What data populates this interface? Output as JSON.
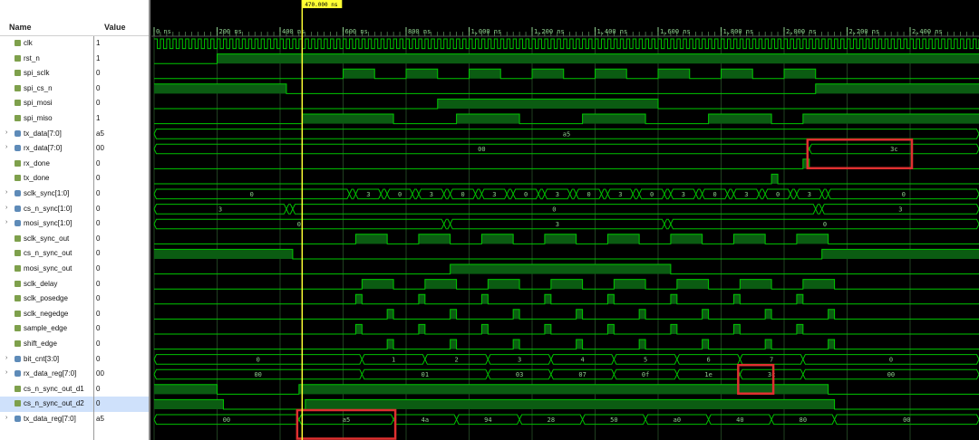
{
  "header": {
    "name_col": "Name",
    "value_col": "Value"
  },
  "cursor": {
    "label": "470.000 ns",
    "time_ns": 470
  },
  "timeline": {
    "ticks": [
      "0 ns",
      "200 ns",
      "400 ns",
      "600 ns",
      "800 ns",
      "1,000 ns",
      "1,200 ns",
      "1,400 ns",
      "1,600 ns",
      "1,800 ns",
      "2,000 ns",
      "2,200 ns",
      "2,400 ns"
    ]
  },
  "signals": [
    {
      "name": "clk",
      "value": "1",
      "kind": "bit",
      "expand": false
    },
    {
      "name": "rst_n",
      "value": "1",
      "kind": "bit",
      "expand": false
    },
    {
      "name": "spi_sclk",
      "value": "0",
      "kind": "bit",
      "expand": false
    },
    {
      "name": "spi_cs_n",
      "value": "0",
      "kind": "bit",
      "expand": false
    },
    {
      "name": "spi_mosi",
      "value": "0",
      "kind": "bit",
      "expand": false
    },
    {
      "name": "spi_miso",
      "value": "1",
      "kind": "bit",
      "expand": false
    },
    {
      "name": "tx_data[7:0]",
      "value": "a5",
      "kind": "bus",
      "expand": true
    },
    {
      "name": "rx_data[7:0]",
      "value": "00",
      "kind": "bus",
      "expand": true
    },
    {
      "name": "rx_done",
      "value": "0",
      "kind": "bit",
      "expand": false
    },
    {
      "name": "tx_done",
      "value": "0",
      "kind": "bit",
      "expand": false
    },
    {
      "name": "sclk_sync[1:0]",
      "value": "0",
      "kind": "bus",
      "expand": true
    },
    {
      "name": "cs_n_sync[1:0]",
      "value": "0",
      "kind": "bus",
      "expand": true
    },
    {
      "name": "mosi_sync[1:0]",
      "value": "0",
      "kind": "bus",
      "expand": true
    },
    {
      "name": "sclk_sync_out",
      "value": "0",
      "kind": "bit",
      "expand": false
    },
    {
      "name": "cs_n_sync_out",
      "value": "0",
      "kind": "bit",
      "expand": false
    },
    {
      "name": "mosi_sync_out",
      "value": "0",
      "kind": "bit",
      "expand": false
    },
    {
      "name": "sclk_delay",
      "value": "0",
      "kind": "bit",
      "expand": false
    },
    {
      "name": "sclk_posedge",
      "value": "0",
      "kind": "bit",
      "expand": false
    },
    {
      "name": "sclk_negedge",
      "value": "0",
      "kind": "bit",
      "expand": false
    },
    {
      "name": "sample_edge",
      "value": "0",
      "kind": "bit",
      "expand": false
    },
    {
      "name": "shift_edge",
      "value": "0",
      "kind": "bit",
      "expand": false
    },
    {
      "name": "bit_cnt[3:0]",
      "value": "0",
      "kind": "bus",
      "expand": true
    },
    {
      "name": "rx_data_reg[7:0]",
      "value": "00",
      "kind": "bus",
      "expand": true
    },
    {
      "name": "cs_n_sync_out_d1",
      "value": "0",
      "kind": "bit",
      "expand": false
    },
    {
      "name": "cs_n_sync_out_d2",
      "value": "0",
      "kind": "bit",
      "expand": false,
      "selected": true
    },
    {
      "name": "tx_data_reg[7:0]",
      "value": "a5",
      "kind": "bus",
      "expand": true
    }
  ],
  "waves": {
    "clk": {
      "type": "clock",
      "period_ns": 20
    },
    "rst_n": {
      "type": "bit",
      "init": 0,
      "edges": [
        200
      ]
    },
    "spi_sclk": {
      "type": "bit",
      "init": 0,
      "edges": [
        600,
        700,
        800,
        900,
        1000,
        1100,
        1200,
        1300,
        1400,
        1500,
        1600,
        1700,
        1800,
        1900,
        2000,
        2100
      ]
    },
    "spi_cs_n": {
      "type": "bit",
      "init": 1,
      "edges": [
        420,
        2100
      ]
    },
    "spi_mosi": {
      "type": "bit",
      "init": 0,
      "edges": [
        900,
        1600
      ]
    },
    "spi_miso": {
      "type": "bit",
      "init": 0,
      "edges": [
        470,
        760,
        960,
        1160,
        1360,
        1560,
        1760,
        1960,
        2060
      ]
    },
    "tx_data[7:0]": {
      "type": "bus",
      "segments": [
        {
          "t": 0,
          "v": "a5"
        }
      ]
    },
    "rx_data[7:0]": {
      "type": "bus",
      "segments": [
        {
          "t": 0,
          "v": "00"
        },
        {
          "t": 2080,
          "v": "3c"
        }
      ]
    },
    "rx_done": {
      "type": "bit",
      "init": 0,
      "edges": [
        2060,
        2080
      ]
    },
    "tx_done": {
      "type": "bit",
      "init": 0,
      "edges": [
        1960,
        1980
      ]
    },
    "sclk_sync[1:0]": {
      "type": "bus",
      "segments": [
        {
          "t": 0,
          "v": "0"
        },
        {
          "t": 620,
          "v": "1"
        },
        {
          "t": 640,
          "v": "3"
        },
        {
          "t": 720,
          "v": "2"
        },
        {
          "t": 740,
          "v": "0"
        },
        {
          "t": 820,
          "v": "1"
        },
        {
          "t": 840,
          "v": "3"
        },
        {
          "t": 920,
          "v": "2"
        },
        {
          "t": 940,
          "v": "0"
        },
        {
          "t": 1020,
          "v": "1"
        },
        {
          "t": 1040,
          "v": "3"
        },
        {
          "t": 1120,
          "v": "2"
        },
        {
          "t": 1140,
          "v": "0"
        },
        {
          "t": 1220,
          "v": "1"
        },
        {
          "t": 1240,
          "v": "3"
        },
        {
          "t": 1320,
          "v": "2"
        },
        {
          "t": 1340,
          "v": "0"
        },
        {
          "t": 1420,
          "v": "1"
        },
        {
          "t": 1440,
          "v": "3"
        },
        {
          "t": 1520,
          "v": "2"
        },
        {
          "t": 1540,
          "v": "0"
        },
        {
          "t": 1620,
          "v": "1"
        },
        {
          "t": 1640,
          "v": "3"
        },
        {
          "t": 1720,
          "v": "2"
        },
        {
          "t": 1740,
          "v": "0"
        },
        {
          "t": 1820,
          "v": "1"
        },
        {
          "t": 1840,
          "v": "3"
        },
        {
          "t": 1920,
          "v": "2"
        },
        {
          "t": 1940,
          "v": "0"
        },
        {
          "t": 2020,
          "v": "1"
        },
        {
          "t": 2040,
          "v": "3"
        },
        {
          "t": 2120,
          "v": "2"
        },
        {
          "t": 2140,
          "v": "0"
        }
      ]
    },
    "cs_n_sync[1:0]": {
      "type": "bus",
      "segments": [
        {
          "t": 0,
          "v": "3"
        },
        {
          "t": 420,
          "v": "2"
        },
        {
          "t": 440,
          "v": "0"
        },
        {
          "t": 2100,
          "v": "1"
        },
        {
          "t": 2120,
          "v": "3"
        }
      ]
    },
    "mosi_sync[1:0]": {
      "type": "bus",
      "segments": [
        {
          "t": 0,
          "v": "0"
        },
        {
          "t": 920,
          "v": "1"
        },
        {
          "t": 940,
          "v": "3"
        },
        {
          "t": 1620,
          "v": "2"
        },
        {
          "t": 1640,
          "v": "0"
        }
      ]
    },
    "sclk_sync_out": {
      "type": "bit",
      "init": 0,
      "edges": [
        640,
        740,
        840,
        940,
        1040,
        1140,
        1240,
        1340,
        1440,
        1540,
        1640,
        1740,
        1840,
        1940,
        2040,
        2140
      ]
    },
    "cs_n_sync_out": {
      "type": "bit",
      "init": 1,
      "edges": [
        440,
        2120
      ]
    },
    "mosi_sync_out": {
      "type": "bit",
      "init": 0,
      "edges": [
        940,
        1640
      ]
    },
    "sclk_delay": {
      "type": "bit",
      "init": 0,
      "edges": [
        660,
        760,
        860,
        960,
        1060,
        1160,
        1260,
        1360,
        1460,
        1560,
        1660,
        1760,
        1860,
        1960,
        2060,
        2160
      ]
    },
    "sclk_posedge": {
      "type": "bit",
      "init": 0,
      "edges": [
        640,
        660,
        840,
        860,
        1040,
        1060,
        1240,
        1260,
        1440,
        1460,
        1640,
        1660,
        1840,
        1860,
        2040,
        2060
      ]
    },
    "sclk_negedge": {
      "type": "bit",
      "init": 0,
      "edges": [
        740,
        760,
        940,
        960,
        1140,
        1160,
        1340,
        1360,
        1540,
        1560,
        1740,
        1760,
        1940,
        1960,
        2140,
        2160
      ]
    },
    "sample_edge": {
      "type": "bit",
      "init": 0,
      "edges": [
        640,
        660,
        840,
        860,
        1040,
        1060,
        1240,
        1260,
        1440,
        1460,
        1640,
        1660,
        1840,
        1860,
        2040,
        2060
      ]
    },
    "shift_edge": {
      "type": "bit",
      "init": 0,
      "edges": [
        740,
        760,
        940,
        960,
        1140,
        1160,
        1340,
        1360,
        1540,
        1560,
        1740,
        1760,
        1940,
        1960,
        2140,
        2160
      ]
    },
    "bit_cnt[3:0]": {
      "type": "bus",
      "segments": [
        {
          "t": 0,
          "v": "0"
        },
        {
          "t": 660,
          "v": "1"
        },
        {
          "t": 860,
          "v": "2"
        },
        {
          "t": 1060,
          "v": "3"
        },
        {
          "t": 1260,
          "v": "4"
        },
        {
          "t": 1460,
          "v": "5"
        },
        {
          "t": 1660,
          "v": "6"
        },
        {
          "t": 1860,
          "v": "7"
        },
        {
          "t": 2060,
          "v": "0"
        }
      ]
    },
    "rx_data_reg[7:0]": {
      "type": "bus",
      "segments": [
        {
          "t": 0,
          "v": "00"
        },
        {
          "t": 660,
          "v": "01"
        },
        {
          "t": 1060,
          "v": "03"
        },
        {
          "t": 1260,
          "v": "07"
        },
        {
          "t": 1460,
          "v": "0f"
        },
        {
          "t": 1660,
          "v": "1e"
        },
        {
          "t": 1860,
          "v": "3c"
        },
        {
          "t": 2060,
          "v": "00"
        }
      ]
    },
    "cs_n_sync_out_d1": {
      "type": "bit",
      "init": 1,
      "edges": [
        200,
        460,
        2140
      ]
    },
    "cs_n_sync_out_d2": {
      "type": "bit",
      "init": 1,
      "edges": [
        220,
        480,
        2160
      ]
    },
    "tx_data_reg[7:0]": {
      "type": "bus",
      "segments": [
        {
          "t": 0,
          "v": "00"
        },
        {
          "t": 460,
          "v": "a5"
        },
        {
          "t": 760,
          "v": "4a"
        },
        {
          "t": 960,
          "v": "94"
        },
        {
          "t": 1160,
          "v": "28"
        },
        {
          "t": 1360,
          "v": "50"
        },
        {
          "t": 1560,
          "v": "a0"
        },
        {
          "t": 1760,
          "v": "40"
        },
        {
          "t": 1960,
          "v": "80"
        },
        {
          "t": 2160,
          "v": "00"
        }
      ]
    }
  },
  "highlights": [
    {
      "signal": "rx_data[7:0]",
      "t0": 2080,
      "t1": 2400
    },
    {
      "signal": "rx_data_reg[7:0]",
      "t0": 1860,
      "t1": 1960
    },
    {
      "signal": "tx_data_reg[7:0]",
      "t0": 460,
      "t1": 760
    }
  ],
  "colors": {
    "wave": "#00c800",
    "fill": "#0b5c12",
    "grid": "#1f3f1f",
    "cursor": "#ffff33",
    "highlight": "#e03030",
    "bus": "#00c000"
  }
}
